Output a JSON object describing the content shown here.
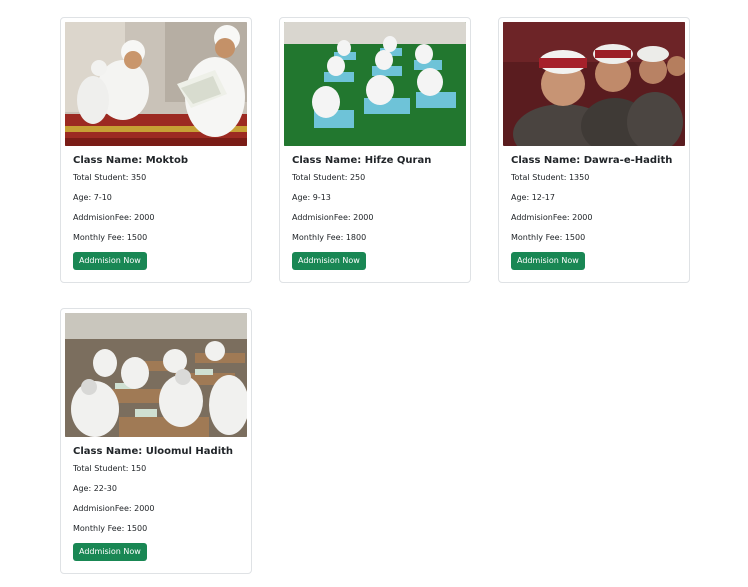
{
  "cards": [
    {
      "title": "Class Name: Moktob",
      "total_students": "Total Student: 350",
      "age": "Age: 7-10",
      "admission_fee": "AddmisionFee: 2000",
      "monthly_fee": "Monthly Fee: 1500",
      "button": "Addmision Now",
      "image": "children-reading-quran-photo"
    },
    {
      "title": "Class Name: Hifze Quran",
      "total_students": "Total Student: 250",
      "age": "Age: 9-13",
      "admission_fee": "AddmisionFee: 2000",
      "monthly_fee": "Monthly Fee: 1800",
      "button": "Addmision Now",
      "image": "students-memorizing-quran-photo"
    },
    {
      "title": "Class Name: Dawra-e-Hadith",
      "total_students": "Total Student: 1350",
      "age": "Age: 12-17",
      "admission_fee": "AddmisionFee: 2000",
      "monthly_fee": "Monthly Fee: 1500",
      "button": "Addmision Now",
      "image": "students-in-turbans-photo"
    },
    {
      "title": "Class Name: Uloomul Hadith",
      "total_students": "Total Student: 150",
      "age": "Age: 22-30",
      "admission_fee": "AddmisionFee: 2000",
      "monthly_fee": "Monthly Fee: 1500",
      "button": "Addmision Now",
      "image": "classroom-study-photo"
    }
  ],
  "colors": {
    "button_bg": "#198754",
    "button_text": "#ffffff",
    "card_border": "#dfe2e5"
  }
}
